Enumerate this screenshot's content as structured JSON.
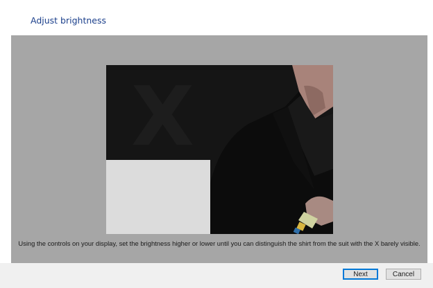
{
  "header": {
    "title": "Adjust brightness"
  },
  "test_image": {
    "description_icon": "calibration-photo",
    "letter": "X"
  },
  "instructions": "Using the controls on your display, set the brightness higher or lower until you can distinguish the shirt from the suit with the X barely visible.",
  "buttons": {
    "next": "Next",
    "cancel": "Cancel"
  },
  "colors": {
    "title": "#1b3f8b",
    "panel": "#a6a6a6",
    "accent": "#0078d7"
  }
}
